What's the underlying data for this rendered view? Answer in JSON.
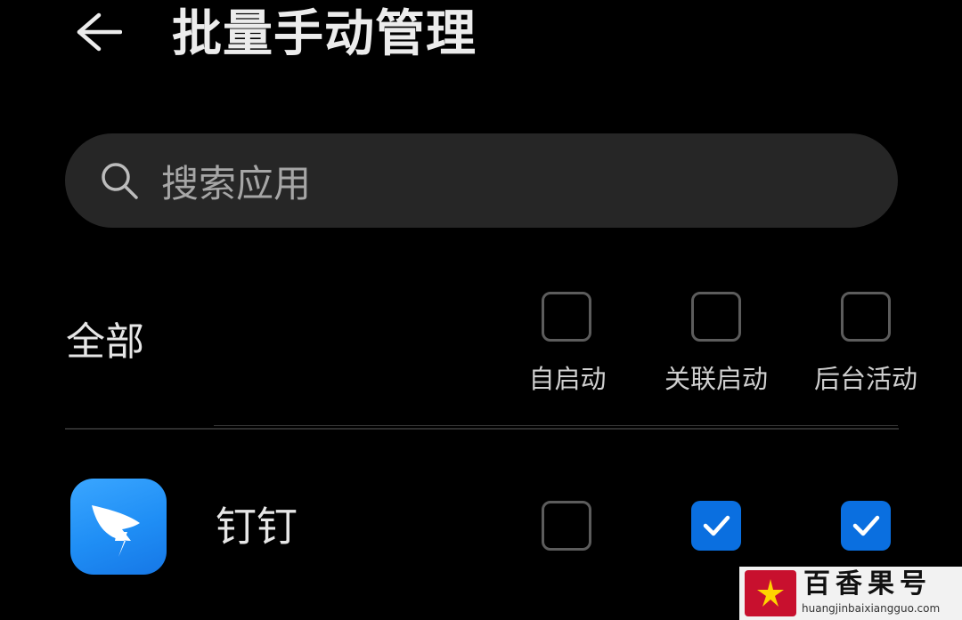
{
  "header": {
    "title": "批量手动管理",
    "back_icon": "arrow-left-icon"
  },
  "search": {
    "placeholder": "搜索应用",
    "icon": "search-icon"
  },
  "bulk": {
    "label": "全部",
    "columns": [
      {
        "label": "自启动",
        "checked": false
      },
      {
        "label": "关联启动",
        "checked": false
      },
      {
        "label": "后台活动",
        "checked": false
      }
    ]
  },
  "apps": [
    {
      "name": "钉钉",
      "icon": "dingtalk-app-icon",
      "auto_start": true,
      "assoc_start": true,
      "background": true,
      "checks": [
        false,
        true,
        true
      ]
    }
  ],
  "colors": {
    "background": "#000000",
    "search_bg": "#262626",
    "checkbox_border": "#5c5c5c",
    "accent": "#0a6fe0"
  },
  "watermark": {
    "main": "百香果号",
    "url": "huangjinbaixiangguo.com"
  }
}
